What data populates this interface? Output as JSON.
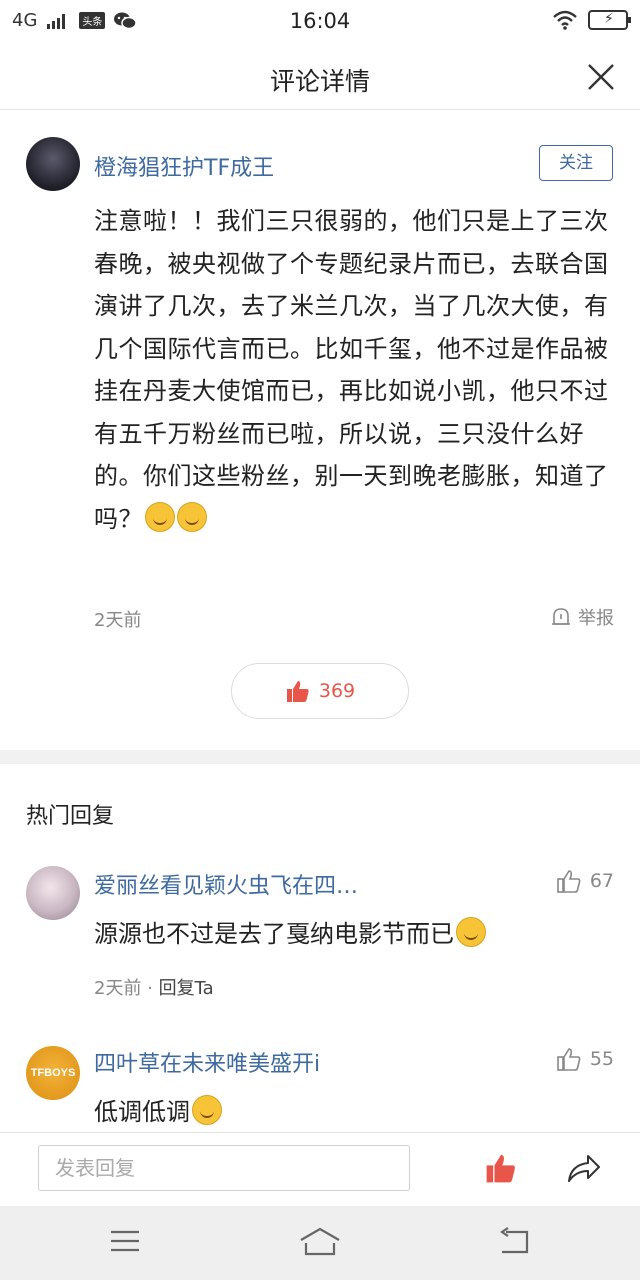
{
  "status_bar": {
    "network": "4G",
    "app_badge": "头条",
    "time": "16:04"
  },
  "header": {
    "title": "评论详情",
    "close_icon": "close-icon"
  },
  "main_comment": {
    "author": "橙海猖狂护TF成王",
    "follow_label": "关注",
    "content": "注意啦！！我们三只很弱的，他们只是上了三次春晚，被央视做了个专题纪录片而已，去联合国演讲了几次，去了米兰几次，当了几次大使，有几个国际代言而已。比如千玺，他不过是作品被挂在丹麦大使馆而已，再比如说小凯，他只不过有五千万粉丝而已啦，所以说，三只没什么好的。你们这些粉丝，别一天到晚老膨胀，知道了吗？",
    "emojis": [
      "grin-emoji",
      "grin-emoji"
    ],
    "time": "2天前",
    "report_label": "举报",
    "like_count": "369"
  },
  "hot_replies": {
    "title": "热门回复",
    "items": [
      {
        "author": "爱丽丝看见颖火虫飞在四…",
        "text": "源源也不过是去了戛纳电影节而已",
        "emoji": "grin-emoji",
        "like_count": "67",
        "time": "2天前",
        "separator": "·",
        "reply_label": "回复Ta"
      },
      {
        "author": "四叶草在未来唯美盛开i",
        "avatar_text": "TFBOYS",
        "text": "低调低调",
        "emoji": "laugh-cry-emoji",
        "like_count": "55"
      }
    ]
  },
  "input_bar": {
    "placeholder": "发表回复"
  },
  "colors": {
    "link_blue": "#3f6aa0",
    "like_red": "#e8564a",
    "meta_gray": "#888888"
  }
}
